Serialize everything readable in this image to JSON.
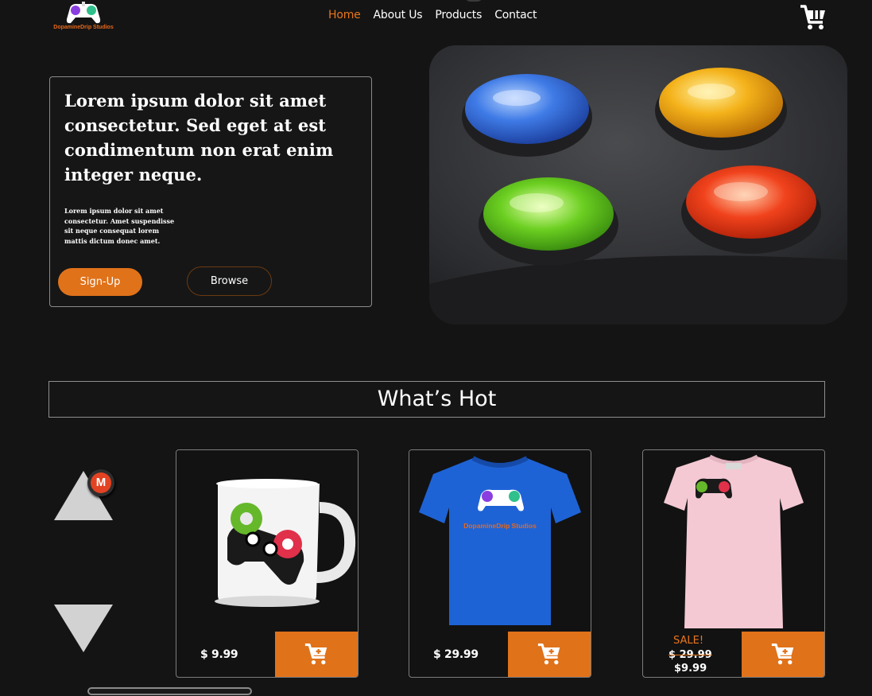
{
  "brand": {
    "logo_text": "DopamineDrip Studios"
  },
  "nav": {
    "items": [
      {
        "label": "Home",
        "active": true
      },
      {
        "label": "About Us",
        "active": false
      },
      {
        "label": "Products",
        "active": false
      },
      {
        "label": "Contact",
        "active": false
      }
    ],
    "cart_icon": "shopping-cart-icon"
  },
  "hero": {
    "title": "Lorem ipsum dolor sit amet consectetur. Sed eget at est condimentum non erat enim integer neque.",
    "subtitle": "Lorem ipsum dolor sit amet consectetur. Amet suspendisse sit neque consequat lorem mattis dictum donec amet.",
    "signup_label": "Sign-Up",
    "browse_label": "Browse"
  },
  "whats_hot": {
    "title": "What’s Hot"
  },
  "badge": {
    "letter": "M"
  },
  "products": [
    {
      "name": "mug",
      "price": "$ 9.99"
    },
    {
      "name": "blue-tshirt",
      "price": "$ 29.99",
      "shirt_text": "DopamineDrip Studios"
    },
    {
      "name": "pink-tshirt",
      "sale_label": "SALE!",
      "old_price": "$ 29.99",
      "new_price": "$9.99"
    }
  ],
  "colors": {
    "background": "#141414",
    "accent": "#e0721a",
    "active_nav": "#e8761c",
    "border": "#8a8a8a"
  }
}
